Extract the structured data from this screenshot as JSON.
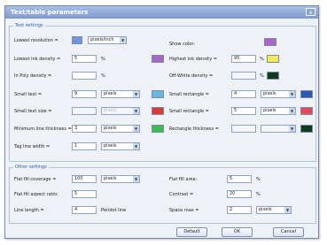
{
  "window": {
    "title": "Text/table parameters",
    "close": "x"
  },
  "text_settings": {
    "legend": "Text settings",
    "rows": [
      {
        "label": "Lowest resolution =",
        "value": "",
        "unit": "pixels/inch"
      },
      {
        "label": "Lowest ink density =",
        "value": "5",
        "unit": "%"
      },
      {
        "label": "In Poly density =",
        "value": "",
        "unit": "%"
      },
      {
        "label": "Small text =",
        "value": "9",
        "unit": "pixels"
      },
      {
        "label": "Small text size =",
        "value": "",
        "unit": "pixels"
      },
      {
        "label": "Minimum line thickness =",
        "value": "3",
        "unit": "pixels"
      },
      {
        "label": "Tag line width =",
        "value": "1",
        "unit": "pixels"
      }
    ],
    "right_rows": [
      {
        "label": "Show color:",
        "value": "",
        "unit": ""
      },
      {
        "label": "Highest ink density =",
        "value": "95",
        "unit": "%"
      },
      {
        "label": "Off-White density =",
        "value": "",
        "unit": "%"
      },
      {
        "label": "Small rectangle =",
        "value": "4",
        "unit": "pixels"
      },
      {
        "label": "Small rectangle =",
        "value": "5",
        "unit": "pixels"
      },
      {
        "label": "Rectangle thickness =",
        "value": "",
        "unit": ""
      }
    ]
  },
  "other_settings": {
    "legend": "Other settings",
    "left_rows": [
      {
        "label": "Flat fill coverage =",
        "value": "100",
        "unit": "pixels"
      },
      {
        "label": "Flat fill aspect ratio:",
        "value": "5",
        "unit": ""
      },
      {
        "label": "Line length =",
        "value": "4",
        "unit": "Peridot line"
      }
    ],
    "right_rows": [
      {
        "label": "Flat fill area:",
        "value": "5",
        "unit": "%"
      },
      {
        "label": "Contrast =",
        "value": "20",
        "unit": "%"
      },
      {
        "label": "Space max =",
        "value": "2",
        "unit": "pixels"
      }
    ]
  },
  "buttons": {
    "default": "Default",
    "ok": "OK",
    "cancel": "Cancel"
  },
  "colors": {
    "title_grad": "#7d99cb",
    "purple": "#a867c6",
    "yellow": "#f2ea58",
    "dark_green": "#0f3b1e",
    "sky_blue": "#67b6e6",
    "blue": "#2e56b5",
    "red": "#d93b35",
    "pink": "#e8485c",
    "green": "#3fbb55"
  }
}
